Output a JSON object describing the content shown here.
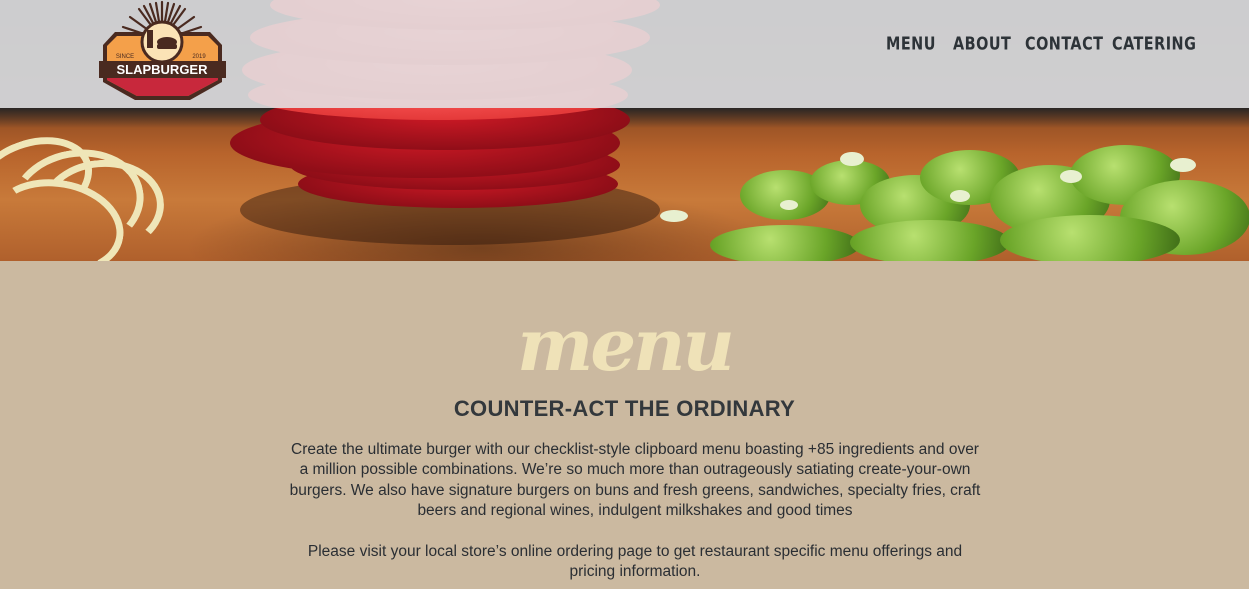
{
  "brand": {
    "name": "SLAPBURGER",
    "since_label": "SINCE",
    "year": "2019"
  },
  "nav": {
    "items": [
      "MENU",
      "ABOUT",
      "CONTACT",
      "CATERING"
    ]
  },
  "content": {
    "script_title": "menu",
    "tagline": "COUNTER-ACT THE ORDINARY",
    "paragraph_1": "Create the ultimate burger with our checklist-style clipboard menu boasting +85 ingredients and over a million possible combinations. We’re so much more than outrageously satiating create-your-own burgers. We also have signature burgers on buns and fresh greens, sandwiches, specialty fries, craft beers and regional wines, indulgent milkshakes and good times",
    "paragraph_2": "Please visit your local store’s online ordering page to get restaurant specific menu offerings and pricing information."
  },
  "colors": {
    "background": "#cbb9a0",
    "header": "#e4e4e6",
    "nav_text": "#2d3338",
    "script_title": "#efe2b8",
    "logo_red": "#c8283c",
    "logo_orange": "#f4a04a",
    "logo_dark": "#4a2a20"
  }
}
